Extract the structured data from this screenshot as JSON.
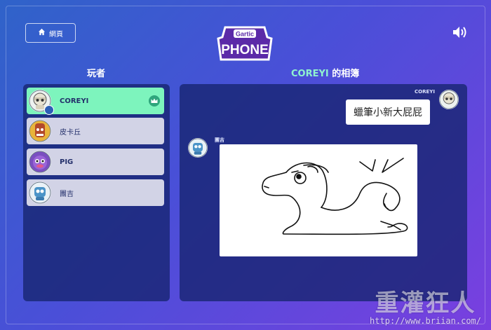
{
  "header": {
    "home_label": "網頁",
    "logo_line1": "Gartic",
    "logo_line2": "PHONE"
  },
  "players_title": "玩者",
  "album_title_name": "COREYI",
  "album_title_suffix": " 的相簿",
  "players": [
    {
      "name": "COREYI",
      "active": true,
      "host": true
    },
    {
      "name": "皮卡丘",
      "active": false
    },
    {
      "name": "PIG",
      "active": false
    },
    {
      "name": "團吉",
      "active": false
    }
  ],
  "album": {
    "msg1_author": "COREYI",
    "msg1_text": "蠟筆小新大屁屁",
    "msg2_author": "團吉"
  },
  "watermark": {
    "title": "重灌狂人",
    "url": "http://www.briian.com/"
  },
  "colors": {
    "active_player": "#7df4bd",
    "album_name": "#8ff2cf"
  }
}
